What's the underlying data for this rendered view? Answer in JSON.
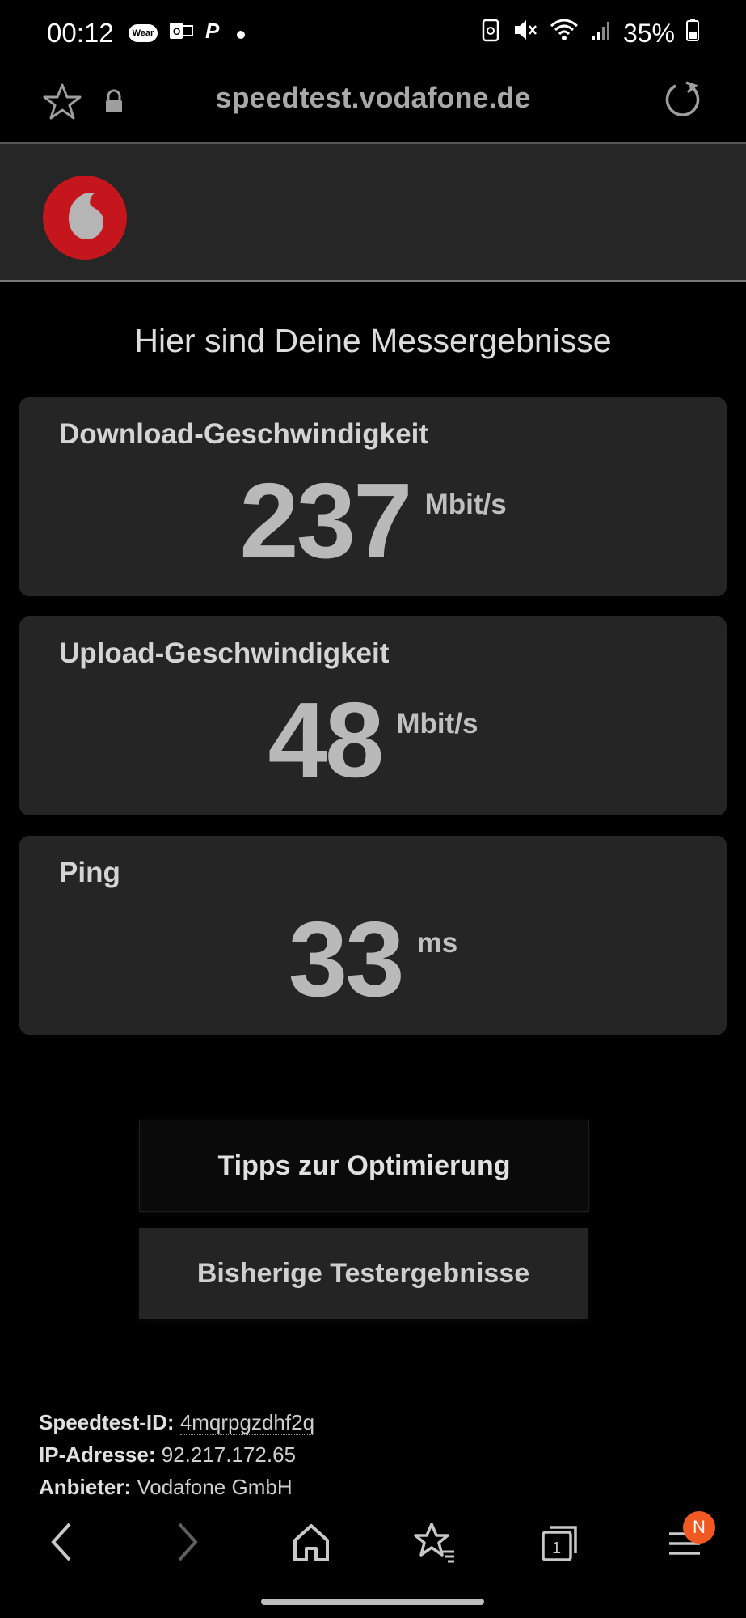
{
  "status_bar": {
    "time": "00:12",
    "wear_label": "Wear",
    "battery": "35%"
  },
  "browser": {
    "url": "speedtest.vodafone.de"
  },
  "brand": {
    "accent_color": "#e60000"
  },
  "page": {
    "title": "Hier sind Deine Messergebnisse"
  },
  "results": [
    {
      "label": "Download-Geschwindigkeit",
      "value": "237",
      "unit": "Mbit/s"
    },
    {
      "label": "Upload-Geschwindigkeit",
      "value": "48",
      "unit": "Mbit/s"
    },
    {
      "label": "Ping",
      "value": "33",
      "unit": "ms"
    }
  ],
  "buttons": {
    "tips": "Tipps zur Optimierung",
    "history": "Bisherige Testergebnisse"
  },
  "info": {
    "id_label": "Speedtest-ID:",
    "id_value": "4mqrpgzdhf2q",
    "ip_label": "IP-Adresse:",
    "ip_value": "92.217.172.65",
    "provider_label": "Anbieter:",
    "provider_value": "Vodafone GmbH"
  },
  "nav": {
    "menu_badge": "N"
  },
  "icons": [
    "star-icon",
    "lock-icon",
    "reload-icon",
    "back-icon",
    "forward-icon",
    "home-icon",
    "bookmarks-icon",
    "tabs-icon",
    "menu-icon"
  ]
}
